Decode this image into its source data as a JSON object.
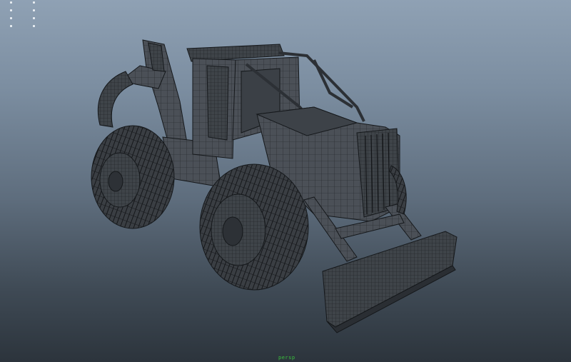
{
  "viewport": {
    "background_top": "#8fa1b4",
    "background_bottom": "#2c343c",
    "wire_color": "#1a1d20",
    "mesh_fill": "#4a4f55"
  },
  "scene": {
    "object": "log-skidder-wireframe-model"
  },
  "hud": {
    "status_text": "persp"
  }
}
